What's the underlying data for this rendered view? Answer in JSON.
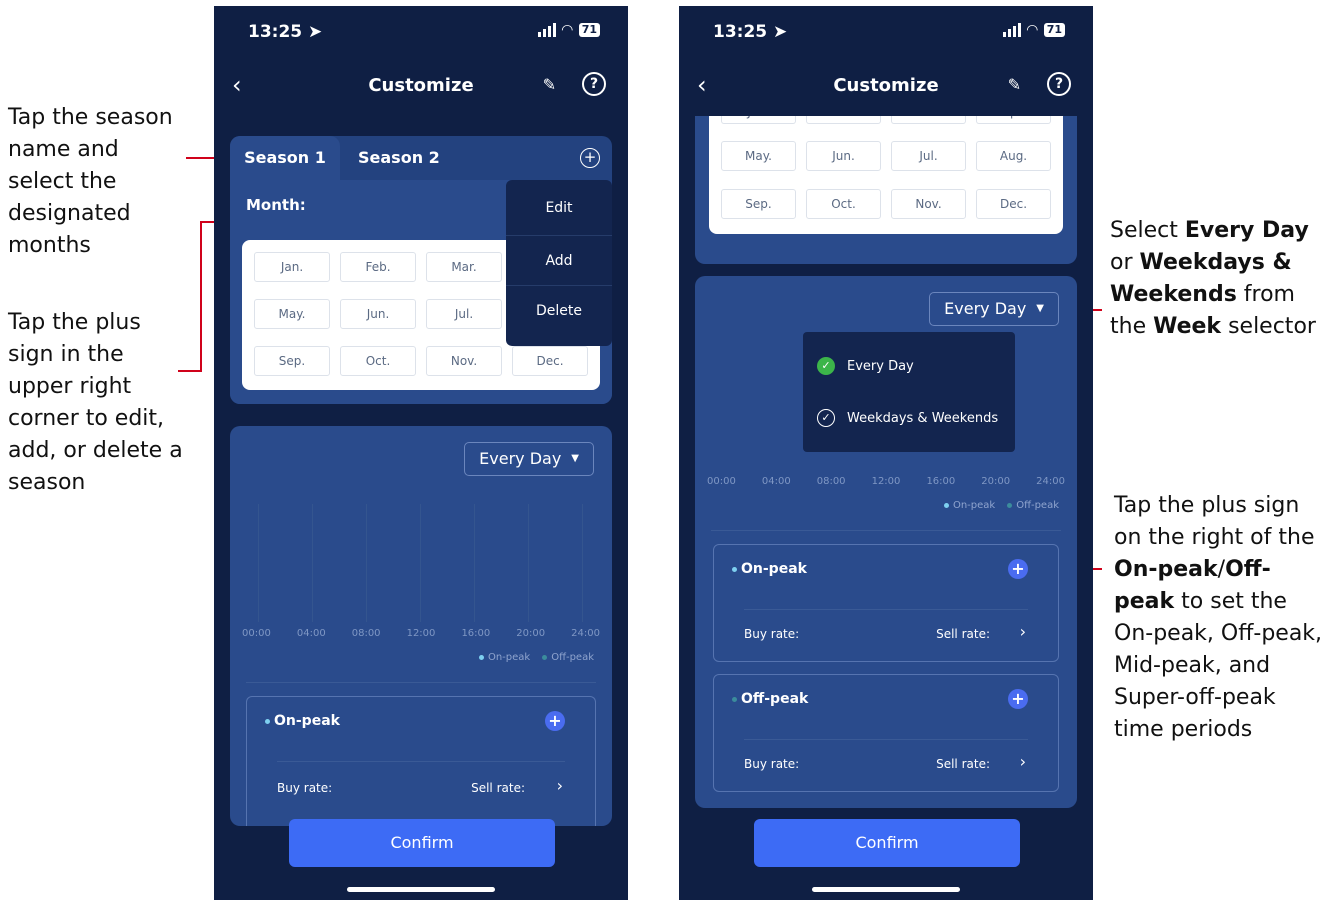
{
  "annotations": {
    "left_1": "Tap the season name and select the designated months",
    "left_2": "Tap the plus sign in the upper right corner to edit, add, or delete a season",
    "right_1_prefix": "Select ",
    "right_1_b1": "Every Day",
    "right_1_mid1": " or ",
    "right_1_b2": "Weekdays & Weekends",
    "right_1_mid2": " from the ",
    "right_1_b3": "Week",
    "right_1_suffix": " selector",
    "right_2_prefix": "Tap the plus sign on the right of the ",
    "right_2_b1": "On-peak",
    "right_2_slash": "/",
    "right_2_b2": "Off-peak",
    "right_2_suffix": " to set the On-peak, Off-peak, Mid-peak, and Super-off-peak time periods"
  },
  "status": {
    "time": "13:25",
    "battery": "71"
  },
  "nav": {
    "title": "Customize",
    "help": "?"
  },
  "tabs": {
    "season1": "Season 1",
    "season2": "Season 2"
  },
  "month_label": "Month:",
  "months": [
    "Jan.",
    "Feb.",
    "Mar.",
    "Apr.",
    "May.",
    "Jun.",
    "Jul.",
    "Aug.",
    "Sep.",
    "Oct.",
    "Nov.",
    "Dec."
  ],
  "season_menu": {
    "edit": "Edit",
    "add": "Add",
    "delete": "Delete"
  },
  "week_select": {
    "value": "Every Day"
  },
  "week_options": {
    "every_day": "Every Day",
    "weekdays_weekends": "Weekdays & Weekends"
  },
  "time_ticks": [
    "00:00",
    "04:00",
    "08:00",
    "12:00",
    "16:00",
    "20:00",
    "24:00"
  ],
  "legend": {
    "on_peak": "On-peak",
    "off_peak": "Off-peak"
  },
  "periods": {
    "on_peak": "On-peak",
    "off_peak": "Off-peak",
    "buy_rate": "Buy rate:",
    "sell_rate": "Sell rate:"
  },
  "confirm": "Confirm",
  "colors": {
    "bg": "#0f1f44",
    "card": "#2a4b8c",
    "accent": "#3d6bf5",
    "on_peak_dot": "#7ed0f0",
    "off_peak_dot": "#3b8c9c",
    "check_green": "#3cb54a"
  }
}
